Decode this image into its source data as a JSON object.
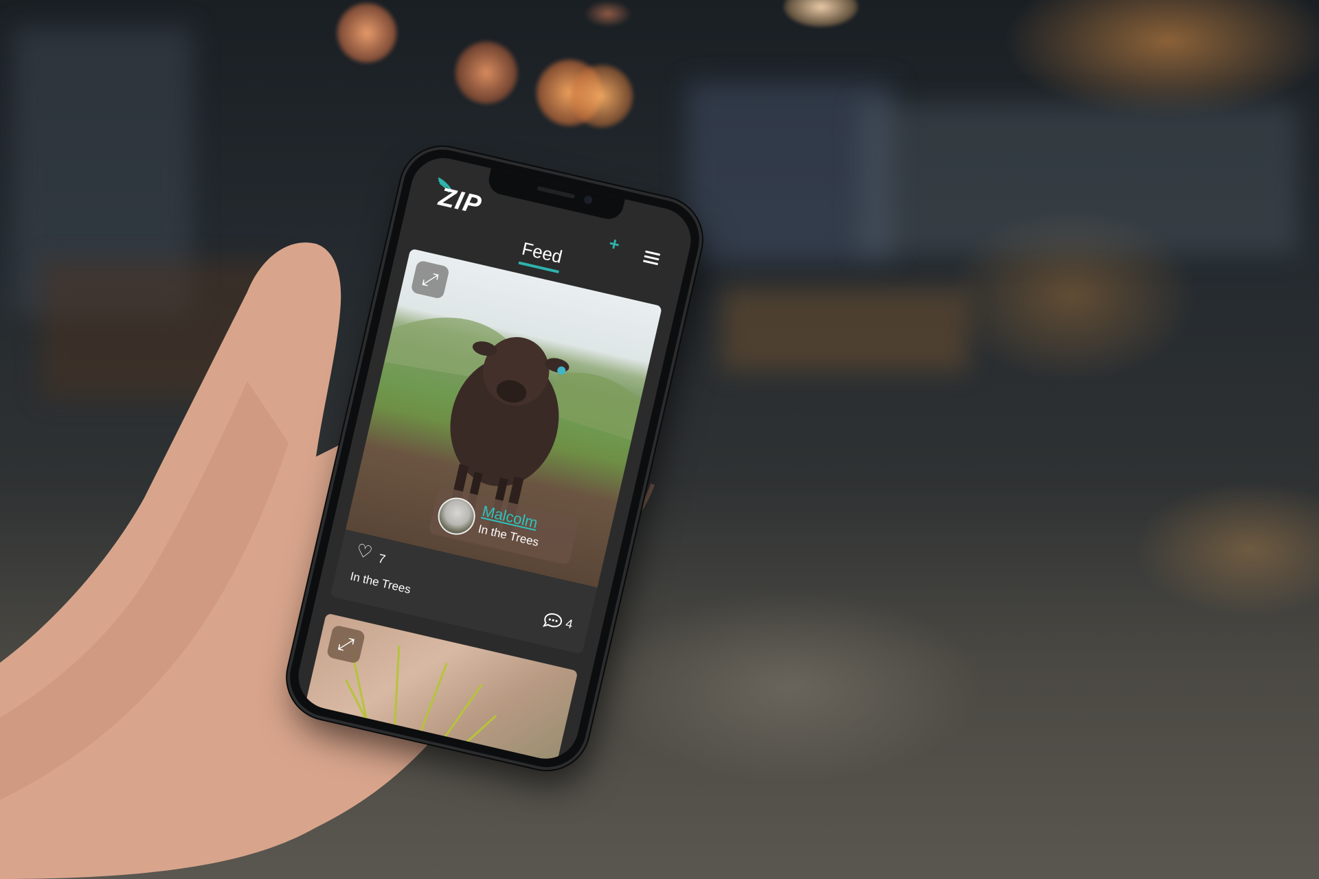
{
  "app": {
    "logo_text": "ZIP",
    "add_icon": "plus-icon",
    "add_label": "+",
    "menu_icon": "hamburger-menu-icon"
  },
  "nav": {
    "active_tab": "Feed"
  },
  "feed": {
    "posts": [
      {
        "expand_icon": "expand-arrows-icon",
        "poster_name": "Malcolm",
        "poster_location": "In the Trees",
        "likes": "7",
        "caption": "In the Trees",
        "comments": "4"
      },
      {
        "expand_icon": "expand-arrows-icon"
      }
    ]
  },
  "colors": {
    "accent": "#2fb3ad",
    "app_background": "#2b2b2b",
    "card_background": "#333333"
  }
}
